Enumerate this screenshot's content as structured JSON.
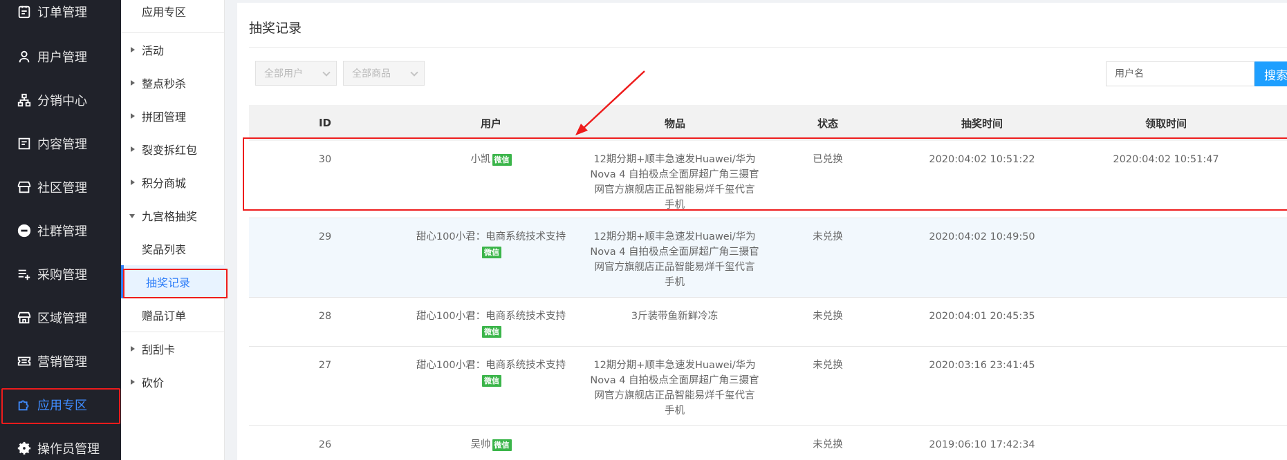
{
  "sidebar": {
    "items": [
      {
        "label": "订单管理",
        "icon": "clipboard-icon"
      },
      {
        "label": "用户管理",
        "icon": "user-icon"
      },
      {
        "label": "分销中心",
        "icon": "hierarchy-icon"
      },
      {
        "label": "内容管理",
        "icon": "document-icon"
      },
      {
        "label": "社区管理",
        "icon": "store-icon"
      },
      {
        "label": "社群管理",
        "icon": "minus-circle-icon"
      },
      {
        "label": "采购管理",
        "icon": "list-add-icon"
      },
      {
        "label": "区域管理",
        "icon": "shop-icon"
      },
      {
        "label": "营销管理",
        "icon": "ticket-icon"
      },
      {
        "label": "应用专区",
        "icon": "puzzle-icon"
      },
      {
        "label": "操作员管理",
        "icon": "gear-icon"
      }
    ],
    "active": "应用专区"
  },
  "submenu": {
    "title": "应用专区",
    "items": [
      {
        "label": "活动"
      },
      {
        "label": "整点秒杀"
      },
      {
        "label": "拼团管理"
      },
      {
        "label": "裂变拆红包"
      },
      {
        "label": "积分商城"
      },
      {
        "label": "九宫格抽奖"
      },
      {
        "label": "奖品列表"
      },
      {
        "label": "抽奖记录"
      },
      {
        "label": "赠品订单"
      },
      {
        "label": "刮刮卡"
      },
      {
        "label": "砍价"
      }
    ]
  },
  "main": {
    "title": "抽奖记录",
    "filters": {
      "user_select": "全部用户",
      "goods_select": "全部商品",
      "search_placeholder": "用户名",
      "search_button": "搜索"
    },
    "table": {
      "headers": [
        "ID",
        "用户",
        "物品",
        "状态",
        "抽奖时间",
        "领取时间"
      ],
      "badge_label": "微信",
      "rows": [
        {
          "id": "30",
          "user": "小凯",
          "goods": "12期分期+顺丰急速发Huawei/华为Nova 4 自拍极点全面屏超广角三摄官网官方旗舰店正品智能易烊千玺代言手机",
          "status": "已兑换",
          "draw_time": "2020:04:02 10:51:22",
          "claim_time": "2020:04:02 10:51:47"
        },
        {
          "id": "29",
          "user": "甜心100小君：电商系统技术支持",
          "goods": "12期分期+顺丰急速发Huawei/华为Nova 4 自拍极点全面屏超广角三摄官网官方旗舰店正品智能易烊千玺代言手机",
          "status": "未兑换",
          "draw_time": "2020:04:02 10:49:50",
          "claim_time": ""
        },
        {
          "id": "28",
          "user": "甜心100小君：电商系统技术支持",
          "goods": "3斤装带鱼新鲜冷冻",
          "status": "未兑换",
          "draw_time": "2020:04:01 20:45:35",
          "claim_time": ""
        },
        {
          "id": "27",
          "user": "甜心100小君：电商系统技术支持",
          "goods": "12期分期+顺丰急速发Huawei/华为Nova 4 自拍极点全面屏超广角三摄官网官方旗舰店正品智能易烊千玺代言手机",
          "status": "未兑换",
          "draw_time": "2020:03:16 23:41:45",
          "claim_time": ""
        },
        {
          "id": "26",
          "user": "吴帅",
          "goods": "",
          "status": "未兑换",
          "draw_time": "2019:06:10 17:42:34",
          "claim_time": ""
        }
      ]
    }
  },
  "colors": {
    "sidebar_bg": "#20222a",
    "accent": "#1e9fff",
    "highlight": "#ee1c1c",
    "badge": "#3bb54a"
  }
}
